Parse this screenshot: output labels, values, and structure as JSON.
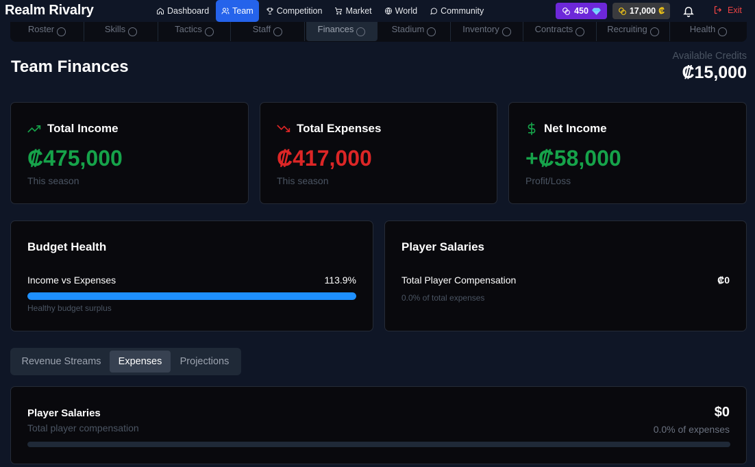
{
  "app": {
    "title": "Realm Rivalry"
  },
  "nav": {
    "items": [
      {
        "label": "Dashboard",
        "icon": "home-icon"
      },
      {
        "label": "Team",
        "icon": "users-icon",
        "active": true
      },
      {
        "label": "Competition",
        "icon": "trophy-icon"
      },
      {
        "label": "Market",
        "icon": "cart-icon"
      },
      {
        "label": "World",
        "icon": "globe-icon"
      },
      {
        "label": "Community",
        "icon": "chat-icon"
      }
    ],
    "gems": "450",
    "credits": "17,000",
    "credit_symbol": "₡",
    "exit_label": "Exit"
  },
  "subtabs": [
    "Roster",
    "Skills",
    "Tactics",
    "Staff",
    "Finances",
    "Stadium",
    "Inventory",
    "Contracts",
    "Recruiting",
    "Health"
  ],
  "page": {
    "title": "Team Finances",
    "available_label": "Available Credits",
    "available_value": "₡15,000"
  },
  "stats": {
    "income": {
      "title": "Total Income",
      "value": "₡475,000",
      "sub": "This season",
      "color": "#16a34a"
    },
    "expenses": {
      "title": "Total Expenses",
      "value": "₡417,000",
      "sub": "This season",
      "color": "#dc2626"
    },
    "net": {
      "title": "Net Income",
      "value": "+₡58,000",
      "sub": "Profit/Loss",
      "color": "#16a34a"
    }
  },
  "budget": {
    "title": "Budget Health",
    "row_label": "Income vs Expenses",
    "row_value": "113.9%",
    "progress": 1.0,
    "sub": "Healthy budget surplus"
  },
  "salaries": {
    "title": "Player Salaries",
    "row_label": "Total Player Compensation",
    "row_value": "₡0",
    "sub": "0.0% of total expenses"
  },
  "tabs": [
    {
      "label": "Revenue Streams"
    },
    {
      "label": "Expenses",
      "active": true
    },
    {
      "label": "Projections"
    }
  ],
  "expense_item": {
    "title": "Player Salaries",
    "sub": "Total player compensation",
    "value": "$0",
    "pct": "0.0% of expenses",
    "progress": 0.0
  }
}
